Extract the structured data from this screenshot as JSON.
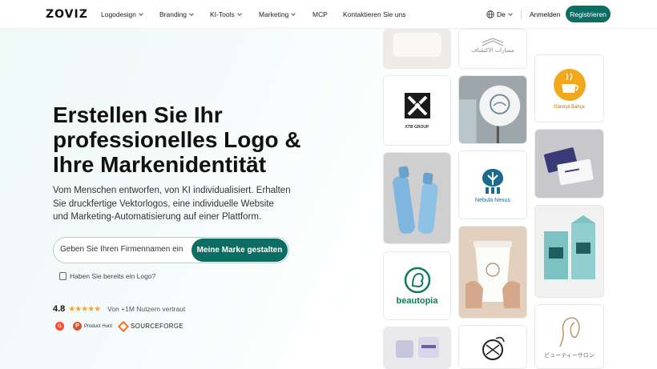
{
  "brand": {
    "name": "ZOVIZ"
  },
  "nav": {
    "items": [
      {
        "label": "Logodesign",
        "dropdown": true
      },
      {
        "label": "Branding",
        "dropdown": true
      },
      {
        "label": "KI-Tools",
        "dropdown": true
      },
      {
        "label": "Marketing",
        "dropdown": true
      },
      {
        "label": "MCP",
        "dropdown": false
      },
      {
        "label": "Kontaktieren Sie uns",
        "dropdown": false
      }
    ],
    "language": "De",
    "login": "Anmelden",
    "register": "Registrieren"
  },
  "hero": {
    "title_lines": [
      "Erstellen Sie Ihr",
      "professionelles Logo &",
      "Ihre Markenidentität"
    ],
    "subtitle_lines": [
      "Vom Menschen entworfen, von KI individualisiert. Erhalten",
      "Sie druckfertige Vektorlogos, eine individuelle Website",
      "und Marketing-Automatisierung auf einer Plattform."
    ],
    "input_placeholder": "Geben Sie Ihren Firmennamen ein",
    "cta": "Meine Marke gestalten",
    "have_logo": "Haben Sie bereits ein Logo?",
    "rating": "4.8",
    "stars": "★★★★★",
    "trust": "Von +1M Nutzern vertraut"
  },
  "badges": {
    "g2": "G",
    "producthunt_letter": "P",
    "producthunt": "Product Hunt",
    "sourceforge": "SOURCEFORGE"
  },
  "gallery": {
    "col1": {
      "xtb": "XTB GROUP",
      "beautopia": "beautopia"
    },
    "col2": {
      "arabic": "مسارات الاكتشاف",
      "nebula": "Nebula Nexus"
    },
    "col3": {
      "gunesli": "Güneşli Bahçe",
      "jp": "ビューティーサロン"
    }
  },
  "colors": {
    "accent": "#0c6e63",
    "star": "#f5a623"
  }
}
